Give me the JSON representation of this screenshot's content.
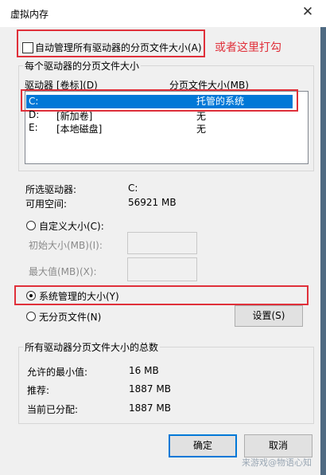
{
  "window": {
    "title": "虚拟内存",
    "close_glyph": "✕"
  },
  "auto_manage": {
    "label": "自动管理所有驱动器的分页文件大小(A)",
    "checked": false
  },
  "annotation_text": "或者这里打勾",
  "drives_group": {
    "title": "每个驱动器的分页文件大小",
    "col_drive": "驱动器 [卷标](D)",
    "col_size": "分页文件大小(MB)",
    "rows": [
      {
        "drive": "C:",
        "label": "",
        "size": "托管的系统",
        "selected": true
      },
      {
        "drive": "D:",
        "label": "[新加卷]",
        "size": "无",
        "selected": false
      },
      {
        "drive": "E:",
        "label": "[本地磁盘]",
        "size": "无",
        "selected": false
      }
    ]
  },
  "selected_drive": {
    "label": "所选驱动器:",
    "value": "C:",
    "space_label": "可用空间:",
    "space_value": "56921 MB"
  },
  "options": {
    "custom_label": "自定义大小(C):",
    "initial_label": "初始大小(MB)(I):",
    "initial_value": "",
    "max_label": "最大值(MB)(X):",
    "max_value": "",
    "system_label": "系统管理的大小(Y)",
    "none_label": "无分页文件(N)",
    "selected": "system",
    "set_button": "设置(S)"
  },
  "totals_group": {
    "title": "所有驱动器分页文件大小的总数",
    "min_label": "允许的最小值:",
    "min_value": "16 MB",
    "rec_label": "推荐:",
    "rec_value": "1887 MB",
    "cur_label": "当前已分配:",
    "cur_value": "1887 MB"
  },
  "footer": {
    "ok": "确定",
    "cancel": "取消",
    "watermark": "来游戏@物语心知"
  },
  "colors": {
    "highlight": "#e0303a",
    "selection": "#0078d7"
  }
}
